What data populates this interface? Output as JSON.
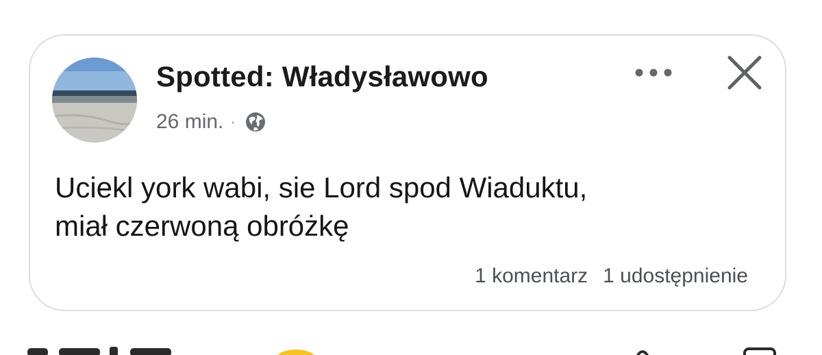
{
  "post": {
    "page_name": "Spotted: Władysławowo",
    "time": "26 min.",
    "separator": "·",
    "audience_icon": "globe-icon",
    "text_lines": [
      "Uciekl york wabi, sie Lord spod Wiaduktu,",
      "miał czerwoną obróżkę"
    ],
    "comments": "1 komentarz",
    "shares": "1 udostępnienie"
  },
  "icons": {
    "avatar": "beach-photo-avatar",
    "more": "more-options-icon",
    "close": "close-icon"
  },
  "colors": {
    "text": "#1c1e21",
    "muted": "#65676b",
    "border": "#dcdde0",
    "reaction_emoji": "#f7c325"
  }
}
